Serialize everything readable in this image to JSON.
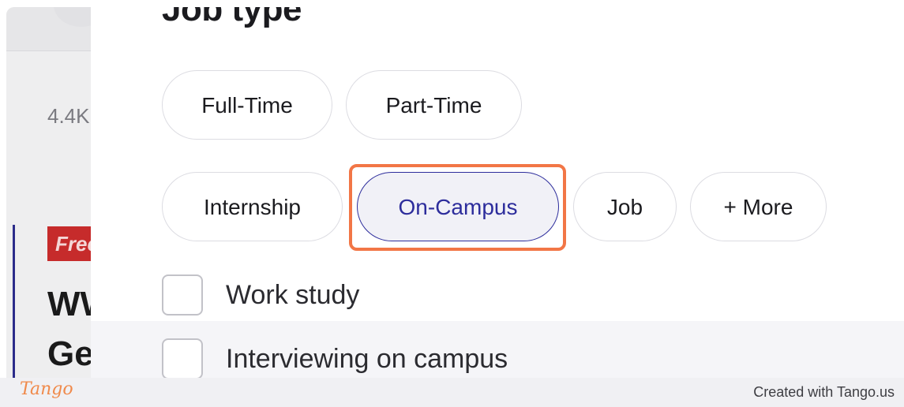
{
  "background": {
    "count_text": "4.4K",
    "badge_text": "Free",
    "headline_line1": "WW",
    "headline_line2": "Ge"
  },
  "filter": {
    "title": "Job type",
    "chips": [
      {
        "label": "Full-Time",
        "selected": false
      },
      {
        "label": "Part-Time",
        "selected": false
      },
      {
        "label": "Internship",
        "selected": false
      },
      {
        "label": "On-Campus",
        "selected": true
      },
      {
        "label": "Job",
        "selected": false
      },
      {
        "label": "+ More",
        "selected": false
      }
    ],
    "checkboxes": [
      {
        "label": "Work study",
        "checked": false
      },
      {
        "label": "Interviewing on campus",
        "checked": false
      }
    ]
  },
  "footer": {
    "logo_text": "Tango",
    "credit": "Created with Tango.us"
  },
  "colors": {
    "selected_accent": "#2d2d9c",
    "highlight": "#f27646",
    "badge": "#c62b2b",
    "logo": "#f08a4b"
  }
}
